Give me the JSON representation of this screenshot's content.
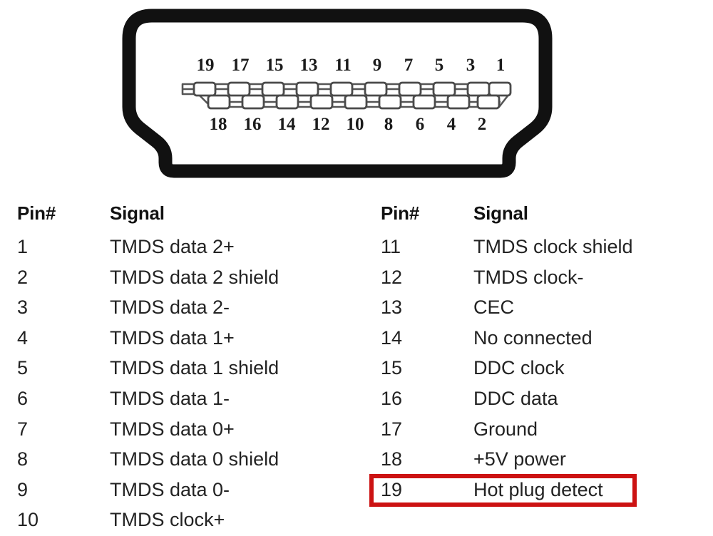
{
  "figure": {
    "name": "hdmi-connector-face",
    "description": "HDMI Type-A connector front view with 19 pin contacts",
    "top_pin_labels": [
      "19",
      "17",
      "15",
      "13",
      "11",
      "9",
      "7",
      "5",
      "3",
      "1"
    ],
    "bottom_pin_labels": [
      "18",
      "16",
      "14",
      "12",
      "10",
      "8",
      "6",
      "4",
      "2"
    ],
    "shell_color": "#111111",
    "pin_outline_color": "#4a4a4a"
  },
  "table": {
    "columns": [
      {
        "name": "left",
        "header": {
          "pin": "Pin#",
          "signal": "Signal"
        },
        "rows": [
          {
            "pin": "1",
            "signal": "TMDS data 2+"
          },
          {
            "pin": "2",
            "signal": "TMDS data 2 shield"
          },
          {
            "pin": "3",
            "signal": "TMDS data 2-"
          },
          {
            "pin": "4",
            "signal": "TMDS data 1+"
          },
          {
            "pin": "5",
            "signal": "TMDS data 1 shield"
          },
          {
            "pin": "6",
            "signal": "TMDS data 1-"
          },
          {
            "pin": "7",
            "signal": "TMDS data 0+"
          },
          {
            "pin": "8",
            "signal": "TMDS data 0 shield"
          },
          {
            "pin": "9",
            "signal": "TMDS data 0-"
          },
          {
            "pin": "10",
            "signal": "TMDS clock+"
          }
        ]
      },
      {
        "name": "right",
        "header": {
          "pin": "Pin#",
          "signal": "Signal"
        },
        "rows": [
          {
            "pin": "11",
            "signal": "TMDS clock shield"
          },
          {
            "pin": "12",
            "signal": "TMDS clock-"
          },
          {
            "pin": "13",
            "signal": "CEC"
          },
          {
            "pin": "14",
            "signal": "No connected"
          },
          {
            "pin": "15",
            "signal": "DDC clock"
          },
          {
            "pin": "16",
            "signal": "DDC data"
          },
          {
            "pin": "17",
            "signal": "Ground"
          },
          {
            "pin": "18",
            "signal": "+5V power"
          },
          {
            "pin": "19",
            "signal": "Hot plug detect",
            "highlighted": true
          }
        ]
      }
    ]
  },
  "highlight": {
    "name": "hot-plug-detect-highlight",
    "color": "#cc1212",
    "target_pin": "19"
  }
}
